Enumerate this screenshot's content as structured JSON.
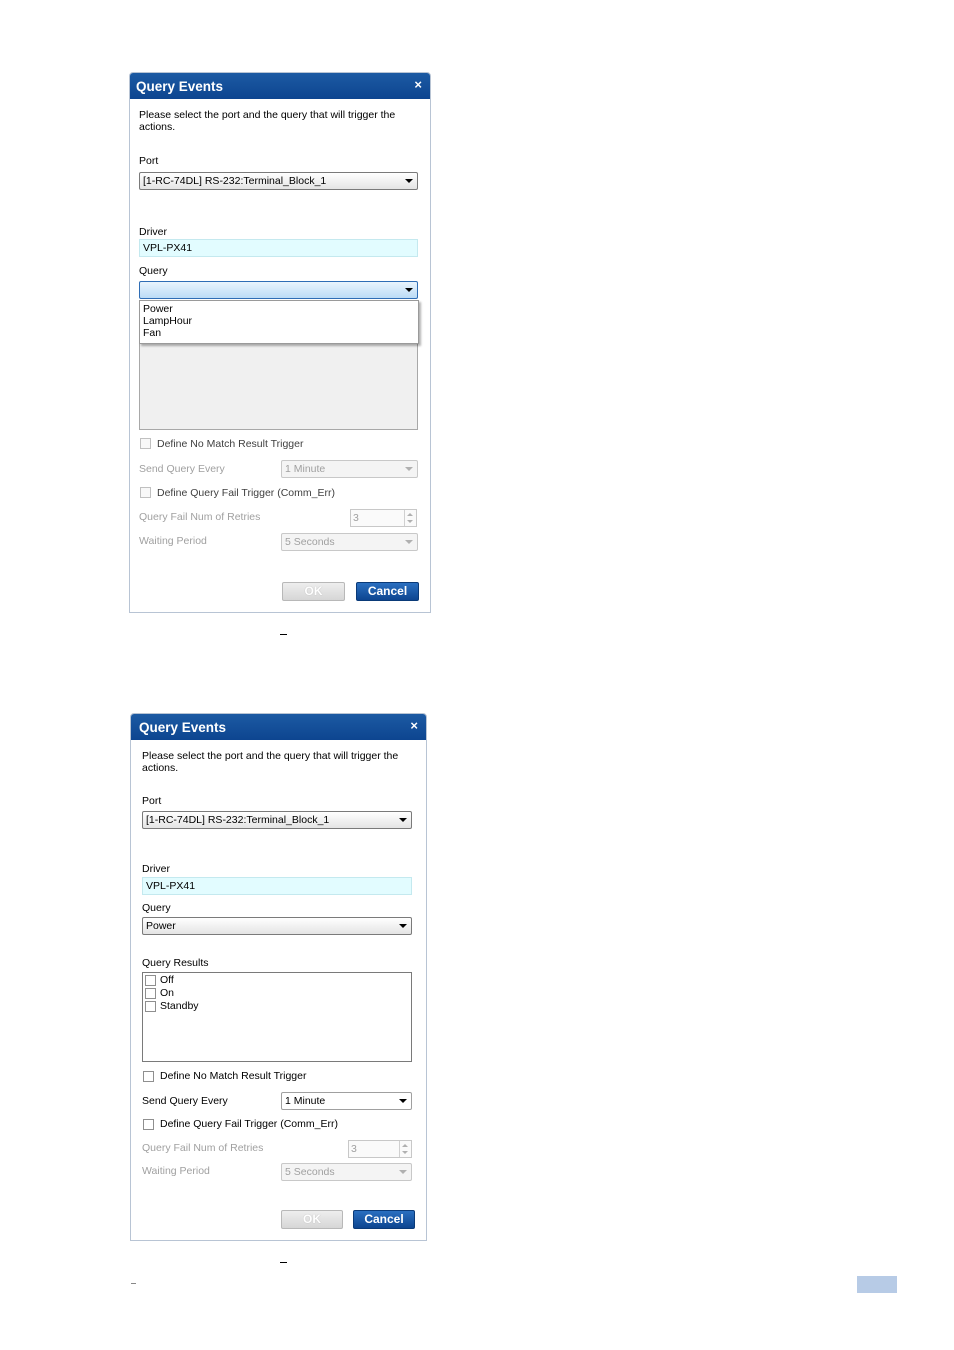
{
  "dialog1": {
    "title": "Query Events",
    "close_icon": "×",
    "instructions_line1": "Please select the port and the query that will trigger the",
    "instructions_line2": "actions.",
    "port_label": "Port",
    "port_value": "[1-RC-74DL] RS-232:Terminal_Block_1",
    "driver_label": "Driver",
    "driver_value": "VPL-PX41",
    "query_label": "Query",
    "query_value": "",
    "query_options": [
      "Power",
      "LampHour",
      "Fan"
    ],
    "no_match_label": "Define No Match Result Trigger",
    "send_query_label": "Send Query Every",
    "send_query_value": "1 Minute",
    "fail_trigger_label": "Define Query Fail Trigger (Comm_Err)",
    "retries_label": "Query Fail Num of Retries",
    "retries_value": "3",
    "waiting_label": "Waiting Period",
    "waiting_value": "5 Seconds",
    "ok_label": "OK",
    "cancel_label": "Cancel"
  },
  "dialog2": {
    "title": "Query Events",
    "close_icon": "×",
    "instructions_line1": "Please select the port and the query that will trigger the",
    "instructions_line2": "actions.",
    "port_label": "Port",
    "port_value": "[1-RC-74DL] RS-232:Terminal_Block_1",
    "driver_label": "Driver",
    "driver_value": "VPL-PX41",
    "query_label": "Query",
    "query_value": "Power",
    "results_label": "Query Results",
    "results": [
      "Off",
      "On",
      "Standby"
    ],
    "no_match_label": "Define No Match Result Trigger",
    "send_query_label": "Send Query Every",
    "send_query_value": "1 Minute",
    "fail_trigger_label": "Define Query Fail Trigger (Comm_Err)",
    "retries_label": "Query Fail Num of Retries",
    "retries_value": "3",
    "waiting_label": "Waiting Period",
    "waiting_value": "5 Seconds",
    "ok_label": "OK",
    "cancel_label": "Cancel"
  }
}
